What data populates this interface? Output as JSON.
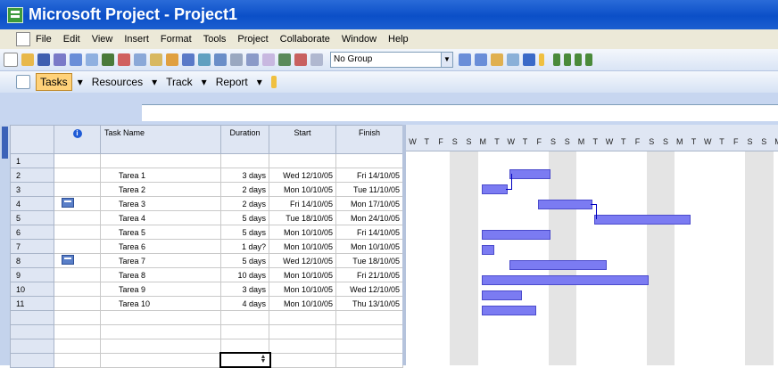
{
  "window": {
    "title": "Microsoft Project - Project1"
  },
  "menu": [
    "File",
    "Edit",
    "View",
    "Insert",
    "Format",
    "Tools",
    "Project",
    "Collaborate",
    "Window",
    "Help"
  ],
  "toolbar": {
    "group_value": "No Group"
  },
  "guide": {
    "tasks": "Tasks",
    "resources": "Resources",
    "track": "Track",
    "report": "Report"
  },
  "columns": {
    "indicators": "i",
    "name": "Task Name",
    "duration": "Duration",
    "start": "Start",
    "finish": "Finish"
  },
  "tasks": [
    {
      "id": "1",
      "name": "",
      "duration": "",
      "start": "",
      "finish": ""
    },
    {
      "id": "2",
      "name": "Tarea 1",
      "duration": "3 days",
      "start": "Wed 12/10/05",
      "finish": "Fri 14/10/05"
    },
    {
      "id": "3",
      "name": "Tarea 2",
      "duration": "2 days",
      "start": "Mon 10/10/05",
      "finish": "Tue 11/10/05"
    },
    {
      "id": "4",
      "name": "Tarea 3",
      "duration": "2 days",
      "start": "Fri 14/10/05",
      "finish": "Mon 17/10/05"
    },
    {
      "id": "5",
      "name": "Tarea 4",
      "duration": "5 days",
      "start": "Tue 18/10/05",
      "finish": "Mon 24/10/05"
    },
    {
      "id": "6",
      "name": "Tarea 5",
      "duration": "5 days",
      "start": "Mon 10/10/05",
      "finish": "Fri 14/10/05"
    },
    {
      "id": "7",
      "name": "Tarea 6",
      "duration": "1 day?",
      "start": "Mon 10/10/05",
      "finish": "Mon 10/10/05"
    },
    {
      "id": "8",
      "name": "Tarea 7",
      "duration": "5 days",
      "start": "Wed 12/10/05",
      "finish": "Tue 18/10/05"
    },
    {
      "id": "9",
      "name": "Tarea 8",
      "duration": "10 days",
      "start": "Mon 10/10/05",
      "finish": "Fri 21/10/05"
    },
    {
      "id": "10",
      "name": "Tarea 9",
      "duration": "3 days",
      "start": "Mon 10/10/05",
      "finish": "Wed 12/10/05"
    },
    {
      "id": "11",
      "name": "Tarea 10",
      "duration": "4 days",
      "start": "Mon 10/10/05",
      "finish": "Thu 13/10/05"
    }
  ],
  "timescale_days": [
    "W",
    "T",
    "F",
    "S",
    "S",
    "M",
    "T",
    "W",
    "T",
    "F",
    "S",
    "S",
    "M",
    "T",
    "W",
    "T",
    "F",
    "S",
    "S",
    "M",
    "T",
    "W",
    "T",
    "F",
    "S",
    "S",
    "M"
  ],
  "colors": {
    "bar": "#7b7bf2",
    "titlebar": "#0b4fc8",
    "weekend": "#e4e4e4"
  }
}
